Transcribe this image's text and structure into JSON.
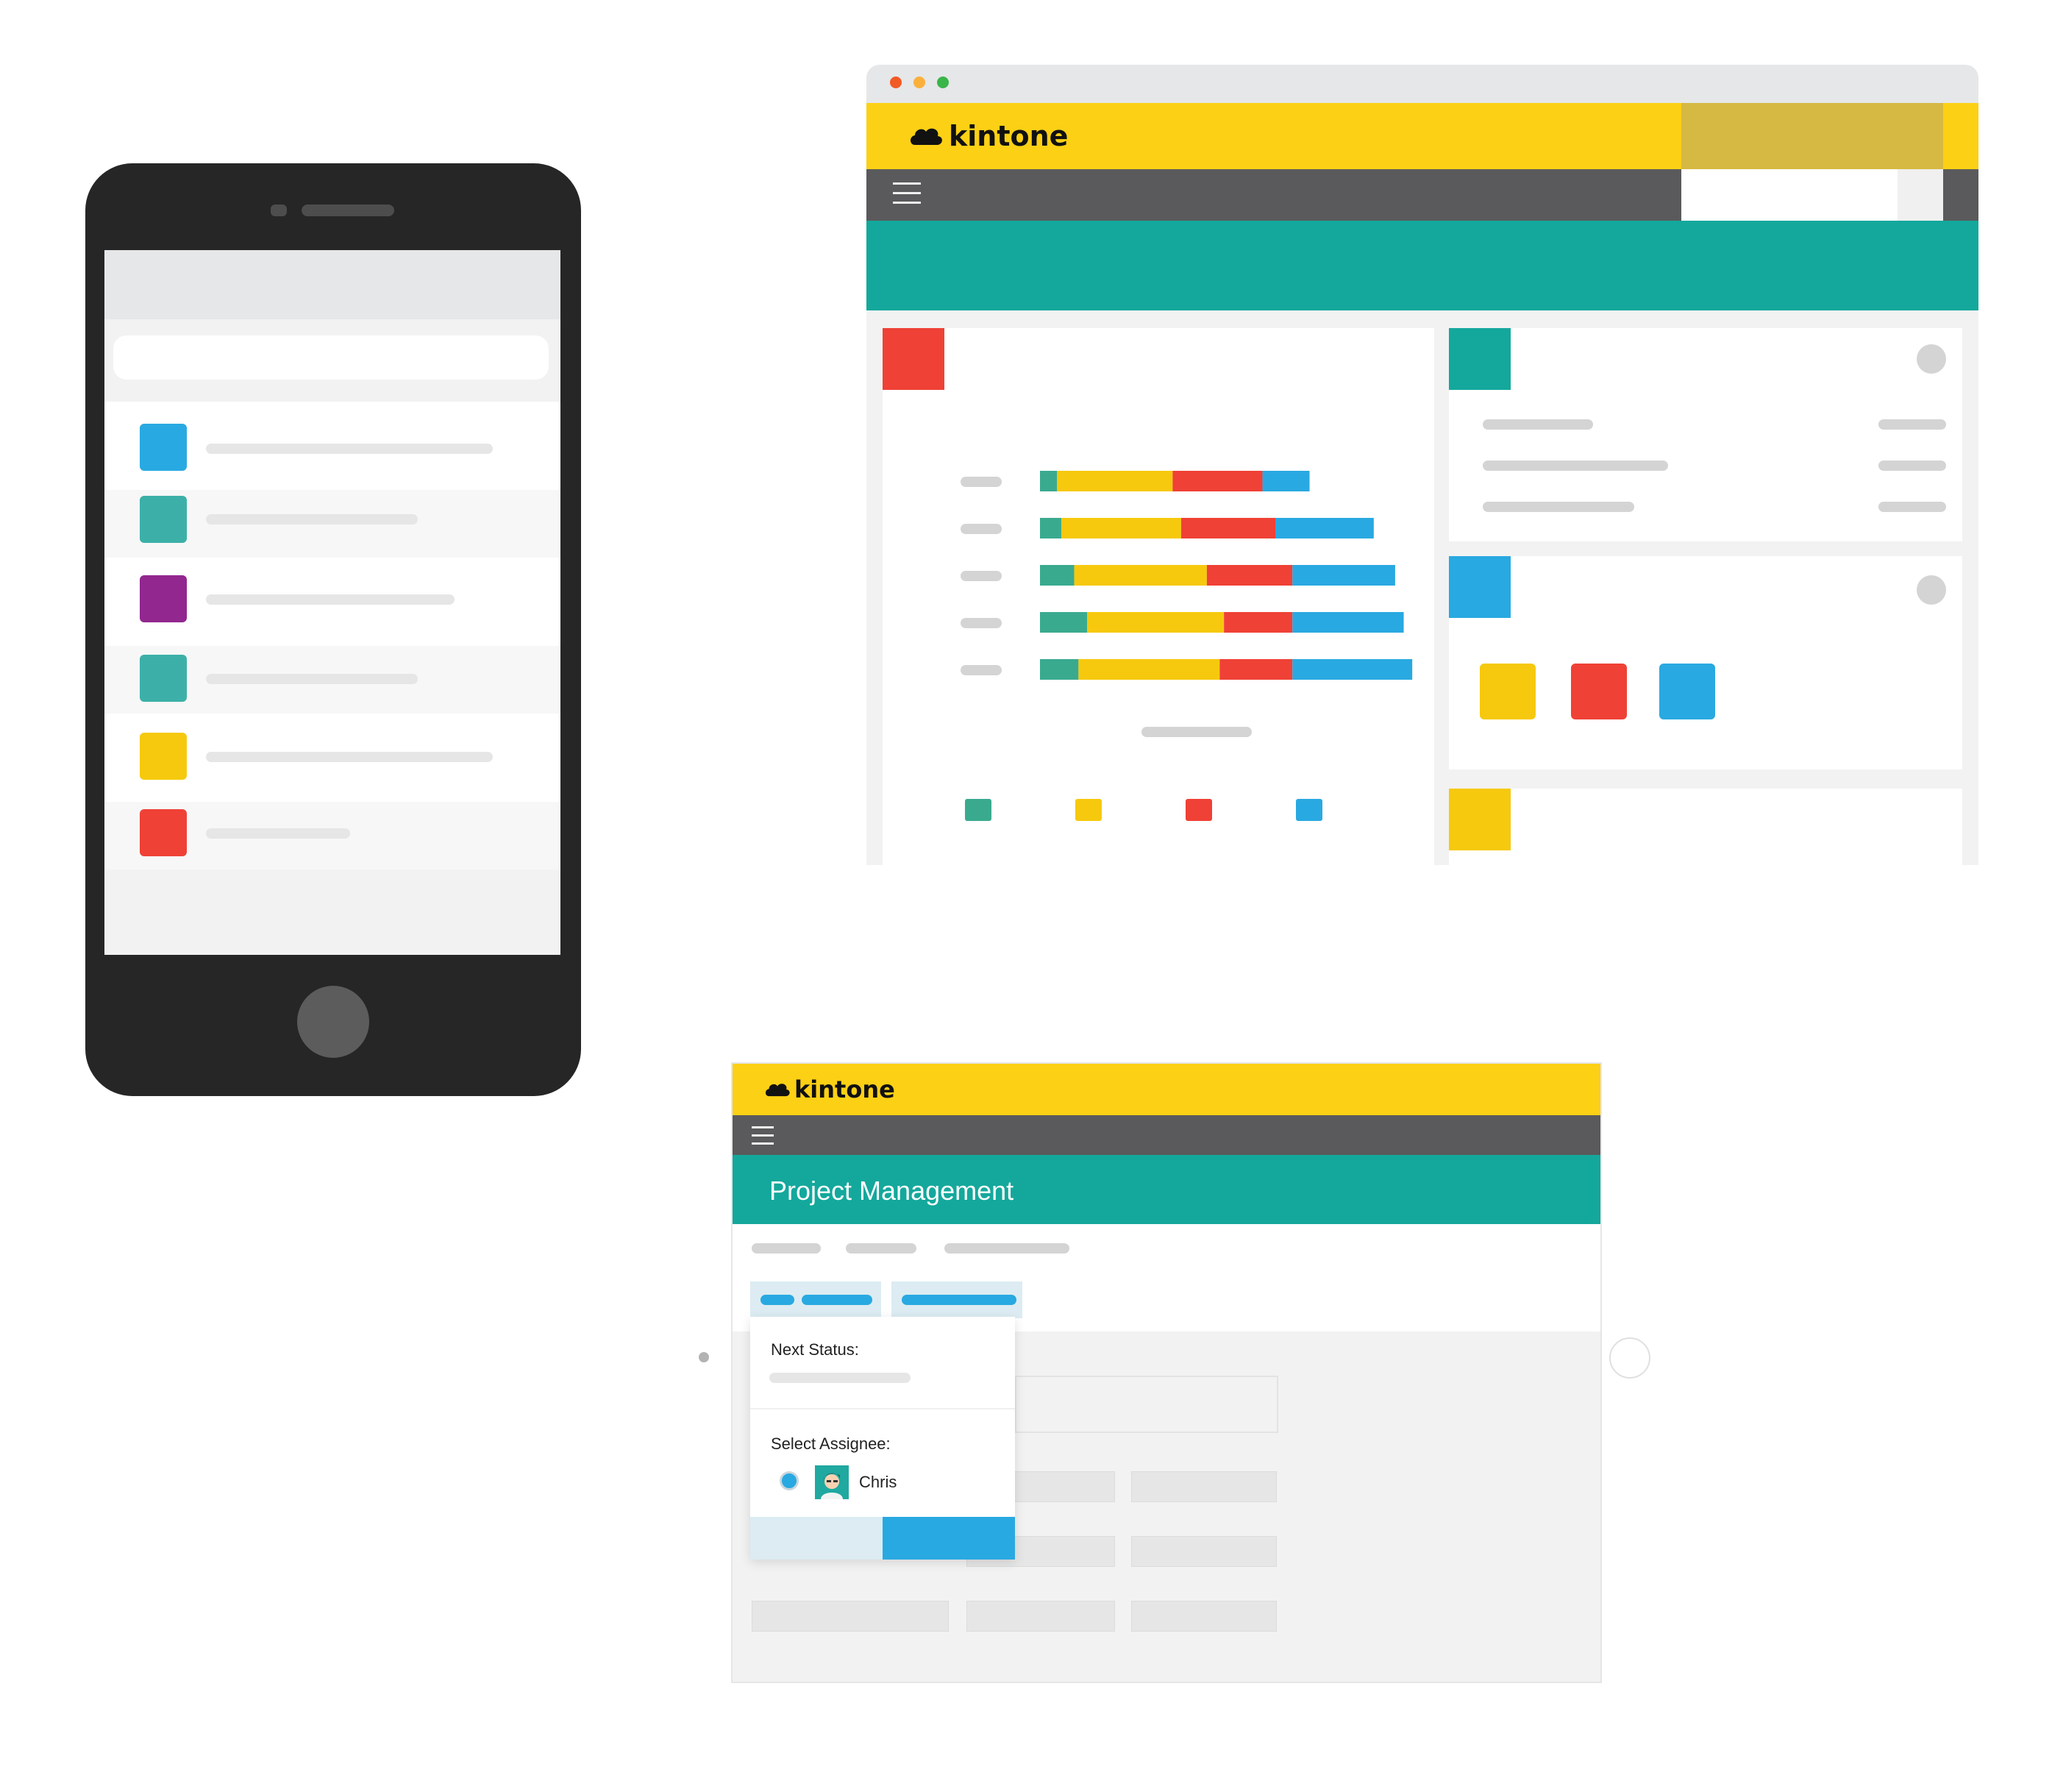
{
  "brand": {
    "logo_text": "kintone",
    "colors": {
      "yellow": "#fcd015",
      "teal": "#14a89c",
      "red": "#ef4136",
      "blue": "#29a9e1",
      "purple": "#92278f",
      "green": "#3cb0a8",
      "dark": "#5a5a5c",
      "phone_body": "#262626"
    }
  },
  "phone": {
    "list_item_colors": [
      "#29a9e1",
      "#3cb0a8",
      "#92278f",
      "#3cb0a8",
      "#f6c90e",
      "#ef4136"
    ]
  },
  "desktop": {
    "title": "kintone",
    "window_dots": [
      "#f15a24",
      "#fbb03b",
      "#39b54a"
    ],
    "chart_data": {
      "type": "bar",
      "orientation": "horizontal",
      "stacked": true,
      "categories": [
        "",
        "",
        "",
        "",
        ""
      ],
      "series": [
        {
          "color": "#3aaa8f",
          "values": [
            4,
            5,
            8,
            11,
            9
          ]
        },
        {
          "color": "#f6c90e",
          "values": [
            27,
            28,
            31,
            32,
            33
          ]
        },
        {
          "color": "#ef4136",
          "values": [
            21,
            22,
            20,
            16,
            17
          ]
        },
        {
          "color": "#29a9e1",
          "values": [
            11,
            23,
            24,
            26,
            28
          ]
        }
      ],
      "legend_colors": [
        "#3aaa8f",
        "#f6c90e",
        "#ef4136",
        "#29a9e1"
      ],
      "xlim": [
        0,
        88
      ]
    }
  },
  "project_window": {
    "logo_text": "kintone",
    "app_title": "Project Management",
    "popup": {
      "next_status_label": "Next Status:",
      "select_assignee_label": "Select Assignee:",
      "assignee_name": "Chris"
    }
  }
}
